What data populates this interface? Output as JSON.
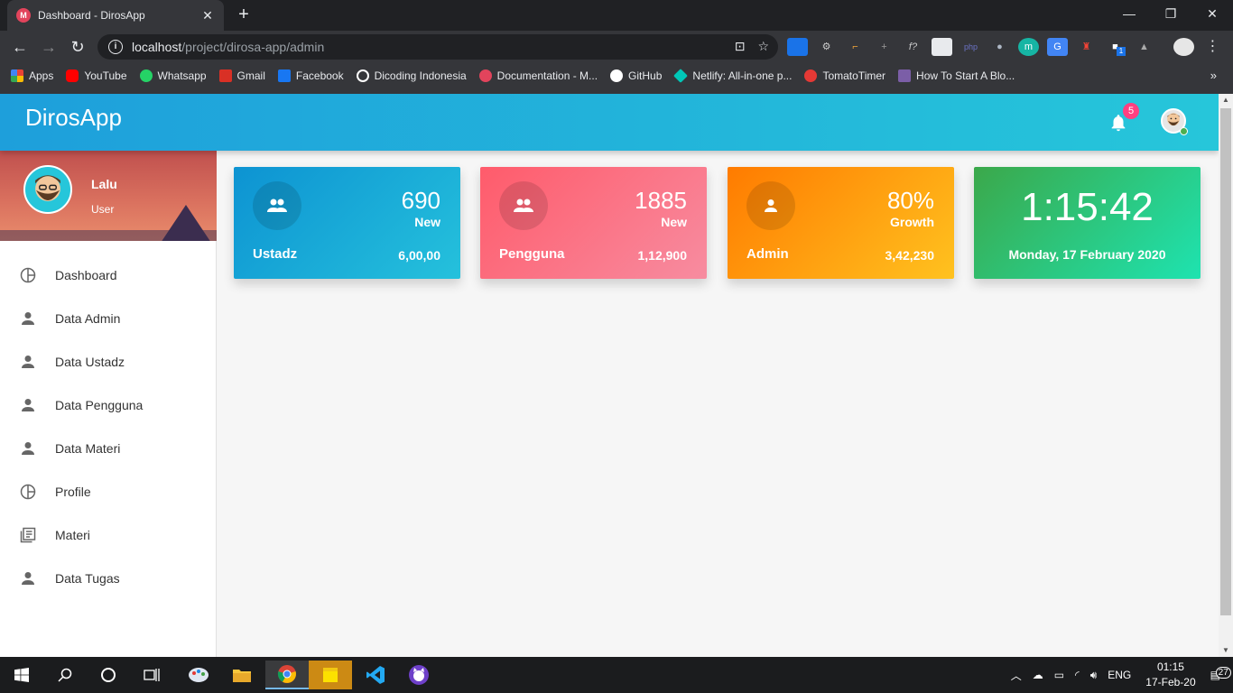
{
  "browser": {
    "tab_title": "Dashboard - DirosApp",
    "url_host": "localhost",
    "url_path": "/project/dirosa-app/admin",
    "bookmarks": [
      "Apps",
      "YouTube",
      "Whatsapp",
      "Gmail",
      "Facebook",
      "Dicoding Indonesia",
      "Documentation - M...",
      "GitHub",
      "Netlify: All-in-one p...",
      "TomatoTimer",
      "How To Start A Blo..."
    ],
    "bookmark_colors": [
      "#ea4335",
      "#ff0000",
      "#25d366",
      "#d93025",
      "#1877f2",
      "#ffffff",
      "#e2445c",
      "#ffffff",
      "#00c7b7",
      "#e53935",
      "#7b5ea7"
    ],
    "ext_badge": "1"
  },
  "app": {
    "brand": "DirosApp",
    "notification_count": "5",
    "user": {
      "name": "Lalu",
      "role": "User"
    }
  },
  "sidebar": {
    "items": [
      {
        "label": "Dashboard",
        "icon": "pie-chart-icon"
      },
      {
        "label": "Data Admin",
        "icon": "person-icon"
      },
      {
        "label": "Data Ustadz",
        "icon": "person-icon"
      },
      {
        "label": "Data Pengguna",
        "icon": "person-icon"
      },
      {
        "label": "Data Materi",
        "icon": "person-icon"
      },
      {
        "label": "Profile",
        "icon": "pie-chart-icon"
      },
      {
        "label": "Materi",
        "icon": "library-books-icon"
      },
      {
        "label": "Data Tugas",
        "icon": "person-icon"
      }
    ]
  },
  "cards": [
    {
      "value": "690",
      "sub": "New",
      "label": "Ustadz",
      "stat": "6,00,00",
      "icon": "group-icon",
      "gradient": [
        "#0d93d2",
        "#25c1dc"
      ]
    },
    {
      "value": "1885",
      "sub": "New",
      "label": "Pengguna",
      "stat": "1,12,900",
      "icon": "group-icon",
      "gradient": [
        "#ff5b6b",
        "#f78ca0"
      ]
    },
    {
      "value": "80%",
      "sub": "Growth",
      "label": "Admin",
      "stat": "3,42,230",
      "icon": "person-icon",
      "gradient": [
        "#ff7b00",
        "#ffc21f"
      ]
    }
  ],
  "clock": {
    "time": "1:15:42",
    "date": "Monday, 17 February 2020",
    "gradient": [
      "#3ba84a",
      "#1ee3b0"
    ]
  },
  "taskbar": {
    "lang": "ENG",
    "time": "01:15",
    "date": "17-Feb-20",
    "notif_count": "27"
  }
}
